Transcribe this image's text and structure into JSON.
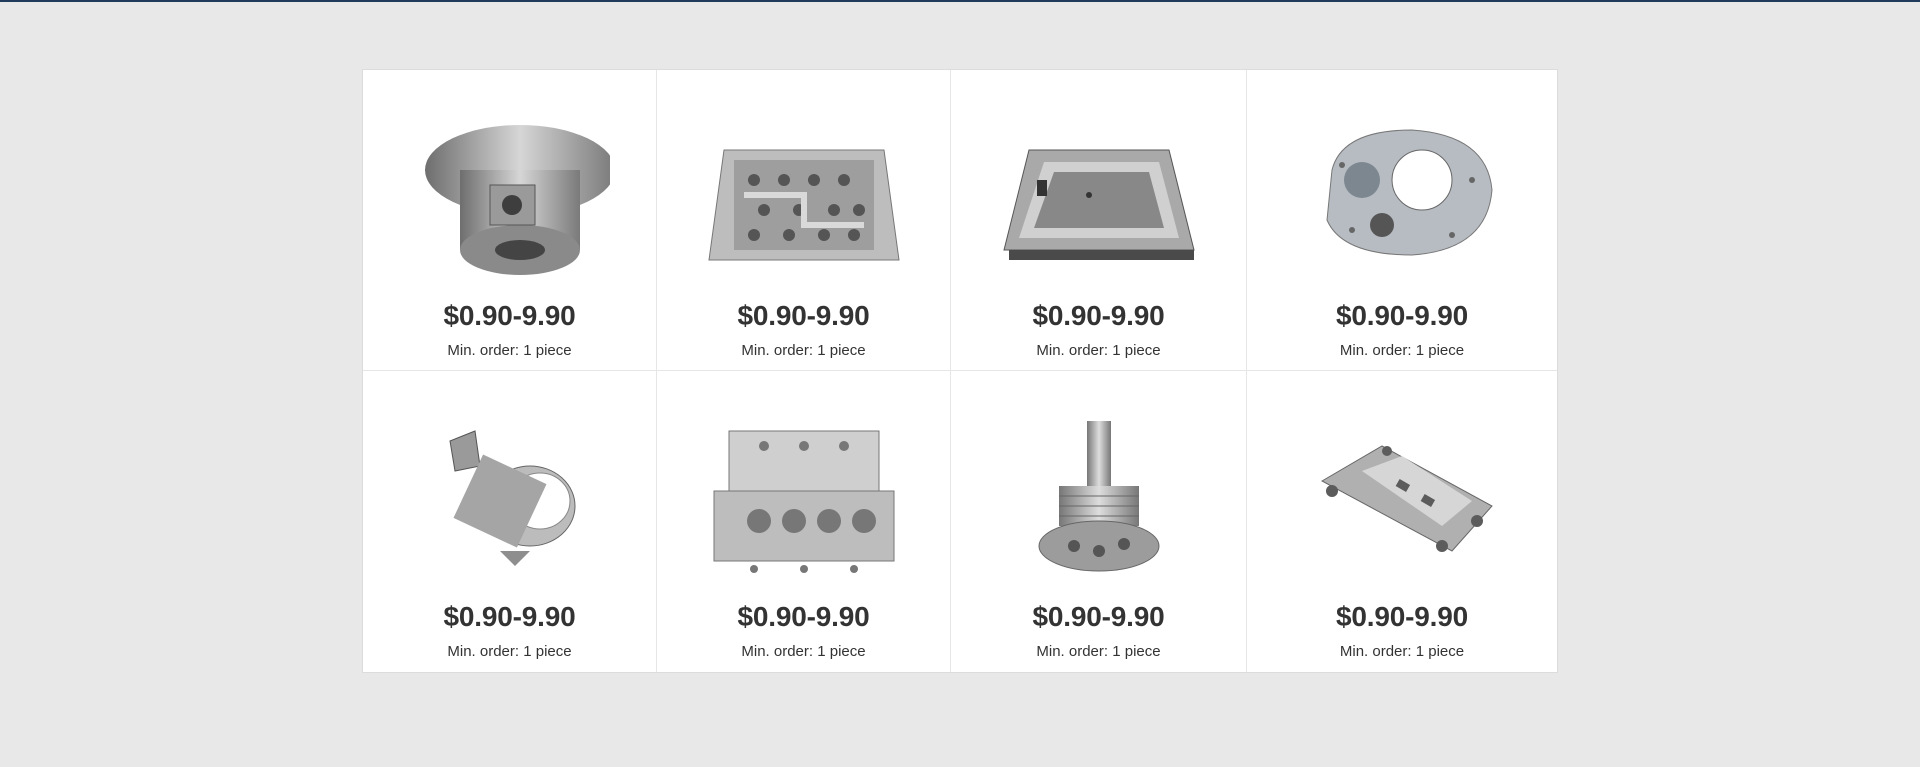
{
  "products": [
    {
      "icon": "cnc-flanged-housing-icon",
      "price": "$0.90-9.90",
      "moq": "Min. order: 1 piece"
    },
    {
      "icon": "cnc-machined-block-icon",
      "price": "$0.90-9.90",
      "moq": "Min. order: 1 piece"
    },
    {
      "icon": "cnc-enclosure-box-icon",
      "price": "$0.90-9.90",
      "moq": "Min. order: 1 piece"
    },
    {
      "icon": "cnc-plate-icon",
      "price": "$0.90-9.90",
      "moq": "Min. order: 1 piece"
    },
    {
      "icon": "cnc-ring-bracket-icon",
      "price": "$0.90-9.90",
      "moq": "Min. order: 1 piece"
    },
    {
      "icon": "cnc-manifold-block-icon",
      "price": "$0.90-9.90",
      "moq": "Min. order: 1 piece"
    },
    {
      "icon": "cnc-shaft-disk-icon",
      "price": "$0.90-9.90",
      "moq": "Min. order: 1 piece"
    },
    {
      "icon": "cnc-bracket-frame-icon",
      "price": "$0.90-9.90",
      "moq": "Min. order: 1 piece"
    }
  ]
}
